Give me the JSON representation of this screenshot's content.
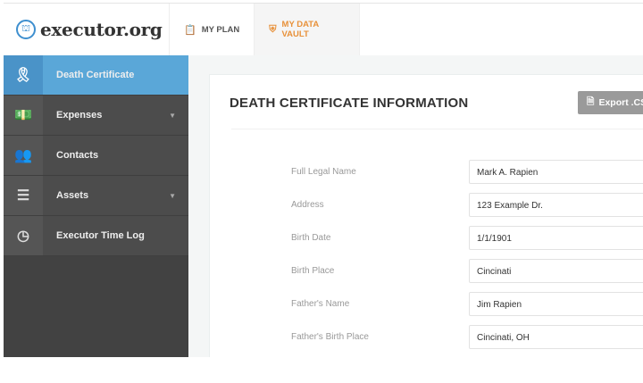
{
  "header": {
    "logo_text": "executor.org",
    "tabs": [
      {
        "label": "MY PLAN",
        "icon": "clipboard-icon"
      },
      {
        "label": "MY DATA VAULT",
        "icon": "shield-icon",
        "active": true
      }
    ]
  },
  "sidebar": {
    "items": [
      {
        "label": "Death Certificate",
        "icon": "award-ribbon-icon",
        "active": true
      },
      {
        "label": "Expenses",
        "icon": "money-icon",
        "has_caret": true
      },
      {
        "label": "Contacts",
        "icon": "people-icon"
      },
      {
        "label": "Assets",
        "icon": "stack-icon",
        "has_caret": true
      },
      {
        "label": "Executor Time Log",
        "icon": "history-clock-icon"
      }
    ]
  },
  "main": {
    "title": "DEATH CERTIFICATE INFORMATION",
    "export_label": "Export .CSV",
    "fields": [
      {
        "label": "Full Legal Name",
        "value": "Mark A. Rapien"
      },
      {
        "label": "Address",
        "value": "123 Example Dr."
      },
      {
        "label": "Birth Date",
        "value": "1/1/1901"
      },
      {
        "label": "Birth Place",
        "value": "Cincinati"
      },
      {
        "label": "Father's Name",
        "value": "Jim Rapien"
      },
      {
        "label": "Father's Birth Place",
        "value": "Cincinati, OH"
      }
    ]
  },
  "colors": {
    "accent": "#5aa7d8",
    "vault": "#e8913a"
  }
}
